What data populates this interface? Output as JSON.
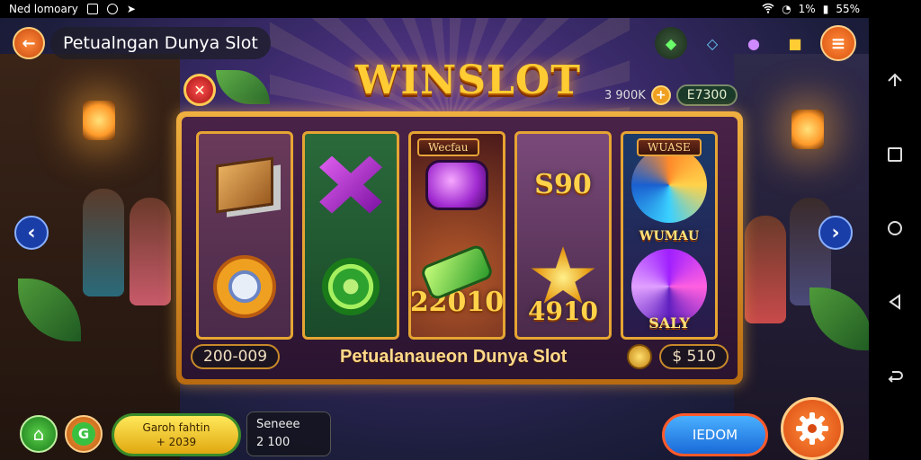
{
  "status_bar": {
    "left_text": "Ned lomoary",
    "right_text_1": "1%",
    "right_text_2": "55%"
  },
  "header": {
    "title": "Petualngan Dunya Slot",
    "back_icon": "back-arrow-icon",
    "menu_icon": "menu-icon",
    "gems": [
      "green-gem-icon",
      "blue-gem-icon",
      "purple-orb-icon",
      "gold-cube-icon"
    ]
  },
  "logo": {
    "text": "WINSLOT"
  },
  "balance": {
    "small_amount": "3 900K",
    "balance_label": "E7300"
  },
  "reels": [
    {
      "label": "",
      "top": "wood-crate-symbol",
      "bottom": "gem-flower-symbol",
      "value": ""
    },
    {
      "label": "",
      "top": "purple-cross-symbol",
      "bottom": "green-coin-symbol",
      "value": ""
    },
    {
      "label": "Wecfau",
      "top": "purple-gem-symbol",
      "bottom": "green-bar-symbol",
      "value": "22010"
    },
    {
      "label": "",
      "top": "S90-symbol",
      "top_text": "S90",
      "bottom": "gold-star-symbol",
      "value": "4910"
    },
    {
      "label": "WUASE",
      "top": "blue-swirl-symbol",
      "middle_text": "WUMAU",
      "bottom": "purple-swirl-symbol",
      "value": "SALY"
    }
  ],
  "frame_bottom": {
    "bet": "200-009",
    "title": "Petualanaueon Dunya Slot",
    "win": "$ 510"
  },
  "bottom_bar": {
    "button_yellow_line1": "Garoh fahtin",
    "button_yellow_line2": "+ 2039",
    "stat_label": "Seneee",
    "stat_value": "2 100",
    "blue_button": "IEDOM"
  },
  "colors": {
    "accent_gold": "#ffcc33",
    "accent_orange": "#e85a14",
    "accent_blue": "#1a6ad8"
  }
}
